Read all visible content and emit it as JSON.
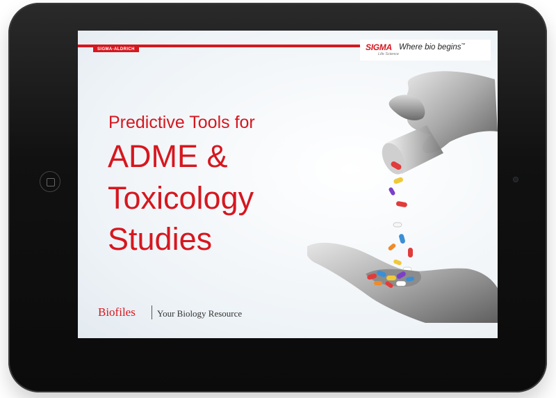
{
  "cover": {
    "publisher_strip": "SIGMA-ALDRICH",
    "logo_main": "SIGMA",
    "logo_sub": "Life Science",
    "logo_tagline": "Where bio begins",
    "logo_tm": "™",
    "title_line1": "Predictive Tools for",
    "title_line2": "ADME &",
    "title_line3": "Toxicology",
    "title_line4": "Studies",
    "footer_brand": "Biofiles",
    "footer_tagline": "Your Biology Resource"
  },
  "colors": {
    "accent_red": "#d6171f",
    "device_frame": "#111111",
    "screen_background": "#eef3f7"
  },
  "icons": {
    "home_button": "home-button-icon",
    "camera": "camera-icon",
    "illustration": "hands-pouring-pills-illustration"
  }
}
